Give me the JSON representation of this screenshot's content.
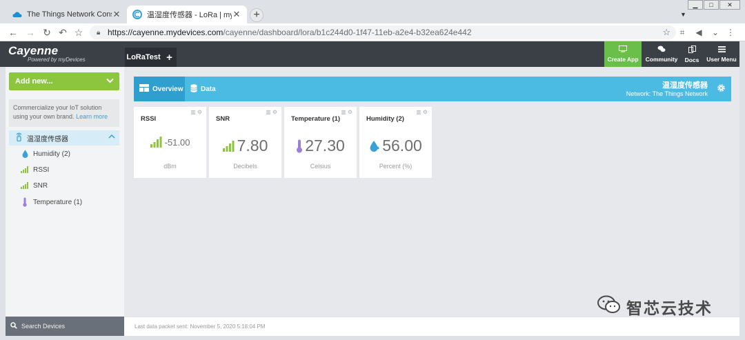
{
  "browser": {
    "tabs": [
      {
        "title": "The Things Network Console",
        "active": false
      },
      {
        "title": "温湿度传感器 - LoRa | myDevic",
        "active": true
      }
    ],
    "url_host": "https://cayenne.mydevices.com",
    "url_path": "/cayenne/dashboard/lora/b1c244d0-1f47-11eb-a2e4-b32ea624e442"
  },
  "header": {
    "brand": "Cayenne",
    "tagline": "Powered by myDevices",
    "project_tab": "LoRaTest",
    "add_project": "+",
    "buttons": {
      "create_app": "Create App",
      "community": "Community",
      "docs": "Docs",
      "user_menu": "User Menu"
    },
    "accent_color": "#6abf4b"
  },
  "sidebar": {
    "add_new": "Add new...",
    "promo_text": "Commercialize your IoT solution using your own brand.",
    "promo_link": "Learn more",
    "device_name": "温湿度传感器",
    "items": [
      {
        "label": "Humidity (2)",
        "icon": "water-drop-icon"
      },
      {
        "label": "RSSI",
        "icon": "signal-bars-icon"
      },
      {
        "label": "SNR",
        "icon": "signal-bars-icon"
      },
      {
        "label": "Temperature (1)",
        "icon": "thermometer-icon"
      }
    ],
    "search_placeholder": "Search Devices"
  },
  "toolbar": {
    "tab_overview": "Overview",
    "tab_data": "Data",
    "device_title": "温湿度传感器",
    "network_text": "Network: The Things Network",
    "color": "#4cbbe4"
  },
  "widgets": [
    {
      "title": "RSSI",
      "value": "-51.00",
      "unit": "dBm",
      "icon": "signal-bars-icon"
    },
    {
      "title": "SNR",
      "value": "7.80",
      "unit": "Decibels",
      "icon": "signal-bars-icon"
    },
    {
      "title": "Temperature (1)",
      "value": "27.30",
      "unit": "Celsius",
      "icon": "thermometer-icon"
    },
    {
      "title": "Humidity (2)",
      "value": "56.00",
      "unit": "Percent (%)",
      "icon": "water-drop-icon"
    }
  ],
  "footer": {
    "last_packet": "Last data packet sent: November 5, 2020 5:18:04 PM"
  },
  "watermark": {
    "text": "智芯云技术"
  }
}
